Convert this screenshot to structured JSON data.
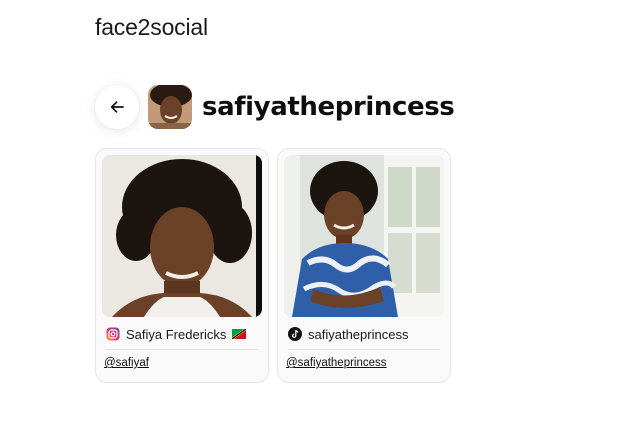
{
  "app": {
    "brand": "face2social"
  },
  "profile": {
    "name": "safiyatheprincess",
    "back_icon": "arrow-left-icon",
    "avatar_icon": "profile-avatar"
  },
  "cards": [
    {
      "platform": "instagram",
      "platform_icon": "instagram-icon",
      "display_name": "Safiya Fredericks",
      "flag_icon": "saint-kitts-and-nevis-flag-icon",
      "handle": "@safiyaf"
    },
    {
      "platform": "tiktok",
      "platform_icon": "tiktok-icon",
      "display_name": "safiyatheprincess",
      "handle": "@safiyatheprincess"
    }
  ],
  "colors": {
    "card_border": "#e6e6e6",
    "card_background": "#fafafa",
    "text": "#111111"
  }
}
